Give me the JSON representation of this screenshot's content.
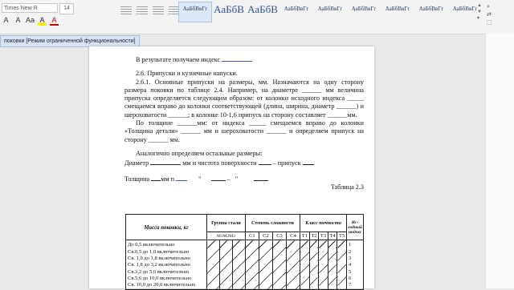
{
  "ribbon": {
    "font_name": "Times New R",
    "font_size": "14",
    "format_buttons": [
      "A",
      "A",
      "Aa",
      "A",
      "A"
    ],
    "styles": [
      {
        "preview": "АаБбВвГг",
        "big": false,
        "selected": true
      },
      {
        "preview": "АаБбВ",
        "big": true,
        "selected": false
      },
      {
        "preview": "АаБбВ",
        "big": true,
        "selected": false
      },
      {
        "preview": "АаБбВвГг",
        "big": false,
        "selected": false
      },
      {
        "preview": "АаБбВвГг",
        "big": false,
        "selected": false
      },
      {
        "preview": "АаБбВвГг",
        "big": false,
        "selected": false
      },
      {
        "preview": "АаБбВвГг",
        "big": false,
        "selected": false
      },
      {
        "preview": "АаБбВвГг",
        "big": false,
        "selected": false
      },
      {
        "preview": "АаБбВвГг",
        "big": false,
        "selected": false
      }
    ]
  },
  "status_strip": "поковки [Режим ограниченной функциональности]",
  "document": {
    "line_result": "В результате получаем индекс",
    "section_title": "2.6. Припуски и кузнечные напуски.",
    "para1": "2.6.1. Основные припуски на размеры, мм. Назначаются на одну сторону размера поковки по таблице 2.4. Например, на диаметре ______ мм величина припуска определяется следующим образом: от колонки исходного индекса _____ смещаемся вправо до колонки соответствующей (длина, ширина, диаметр ______) и шероховатости ______; в колонке 10-1,6 припуск на сторону составляет ______мм.",
    "para2": "По толщине ______мм: от индекса _____ смещаемся вправо до колонки «Толщина детали» ______ мм и шероховатости ______ и определяем припуск на сторону ______ мм.",
    "para3": "Аналогично определяем остальные размеры:",
    "line_diameter_a": "Диаметр",
    "line_diameter_b": "мм и чистота поверхности",
    "line_diameter_c": "–  припуск",
    "line_thickness": "Толщина",
    "line_thickness_mm": "мм п",
    "quote": "\"",
    "dash": "–",
    "table_caption": "Таблица 2.3"
  },
  "table": {
    "col_mass": "Масса поковки, кг",
    "col_group": "Группа стали",
    "col_group_sub": "М1М2М3",
    "col_complexity": "Степень сложности",
    "col_complexity_sub": [
      "С1",
      "С2",
      "С3",
      "С4"
    ],
    "col_accuracy": "Класс точности",
    "col_accuracy_sub": [
      "Т1",
      "Т2",
      "Т3",
      "Т4",
      "Т5"
    ],
    "col_index": "Ис-ходный индекс",
    "rows": [
      "До 0,5 включительно",
      "Св.0,5 до 1,0 включительно",
      "Св. 1,0 до 1,8 включительно",
      "Св. 1,8 до 3,2 включительно",
      "Св.3,2 до 5,6 включительно",
      "Св.5,6 до 10,0 включительно",
      "Св. 10,0 до 20,0 включительно"
    ],
    "index_numbers": [
      "1",
      "2",
      "3",
      "4",
      "5",
      "6",
      "7"
    ]
  }
}
